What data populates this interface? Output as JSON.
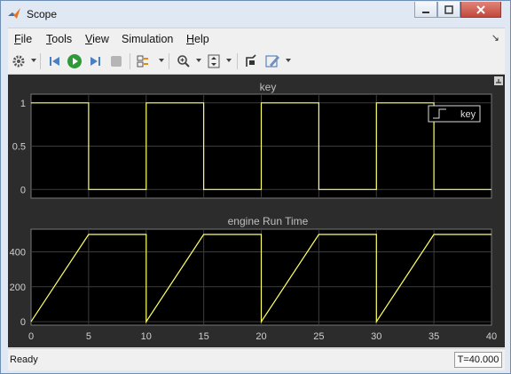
{
  "window": {
    "title": "Scope"
  },
  "menu": [
    {
      "key": "F",
      "rest": "ile"
    },
    {
      "key": "T",
      "rest": "ools"
    },
    {
      "key": "V",
      "rest": "iew"
    },
    {
      "pre": "Simulation",
      "key": "",
      "rest": ""
    },
    {
      "key": "H",
      "rest": "elp"
    }
  ],
  "toolbar": {
    "icons": [
      "gear-icon",
      "step-back-icon",
      "run-icon",
      "step-forward-icon",
      "stop-icon",
      "layout-icon",
      "zoom-icon",
      "scale-axes-icon",
      "highlight-block-icon",
      "edit-icon"
    ]
  },
  "plots": [
    {
      "title": "key",
      "ytick_labels": [
        "1",
        "0.5",
        "0"
      ],
      "legend": "key",
      "colors": {
        "line": "#ffff66",
        "axes": "#000000",
        "grid": "#4a4a4a"
      }
    },
    {
      "title": "engine Run Time",
      "ytick_labels": [
        "400",
        "200",
        "0"
      ],
      "xtick_labels": [
        "0",
        "5",
        "10",
        "15",
        "20",
        "25",
        "30",
        "35",
        "40"
      ]
    }
  ],
  "chart_data": [
    {
      "type": "line",
      "title": "key",
      "xlim": [
        0,
        40
      ],
      "ylim": [
        -0.1,
        1.1
      ],
      "legend": [
        "key"
      ],
      "legend_placement": "top-right",
      "grid": true,
      "series": [
        {
          "name": "key",
          "x": [
            0,
            5,
            5,
            10,
            10,
            15,
            15,
            20,
            20,
            25,
            25,
            30,
            30,
            35,
            35,
            40
          ],
          "y": [
            1,
            1,
            0,
            0,
            1,
            1,
            0,
            0,
            1,
            1,
            0,
            0,
            1,
            1,
            0,
            0
          ]
        }
      ]
    },
    {
      "type": "line",
      "title": "engine Run Time",
      "xlim": [
        0,
        40
      ],
      "ylim": [
        -20,
        530
      ],
      "grid": true,
      "series": [
        {
          "x": [
            0,
            5,
            10,
            10,
            15,
            20,
            20,
            25,
            30,
            30,
            35,
            40
          ],
          "y": [
            0,
            500,
            500,
            0,
            500,
            500,
            0,
            500,
            500,
            0,
            500,
            500
          ]
        }
      ]
    }
  ],
  "status": {
    "text": "Ready",
    "time": "T=40.000"
  }
}
